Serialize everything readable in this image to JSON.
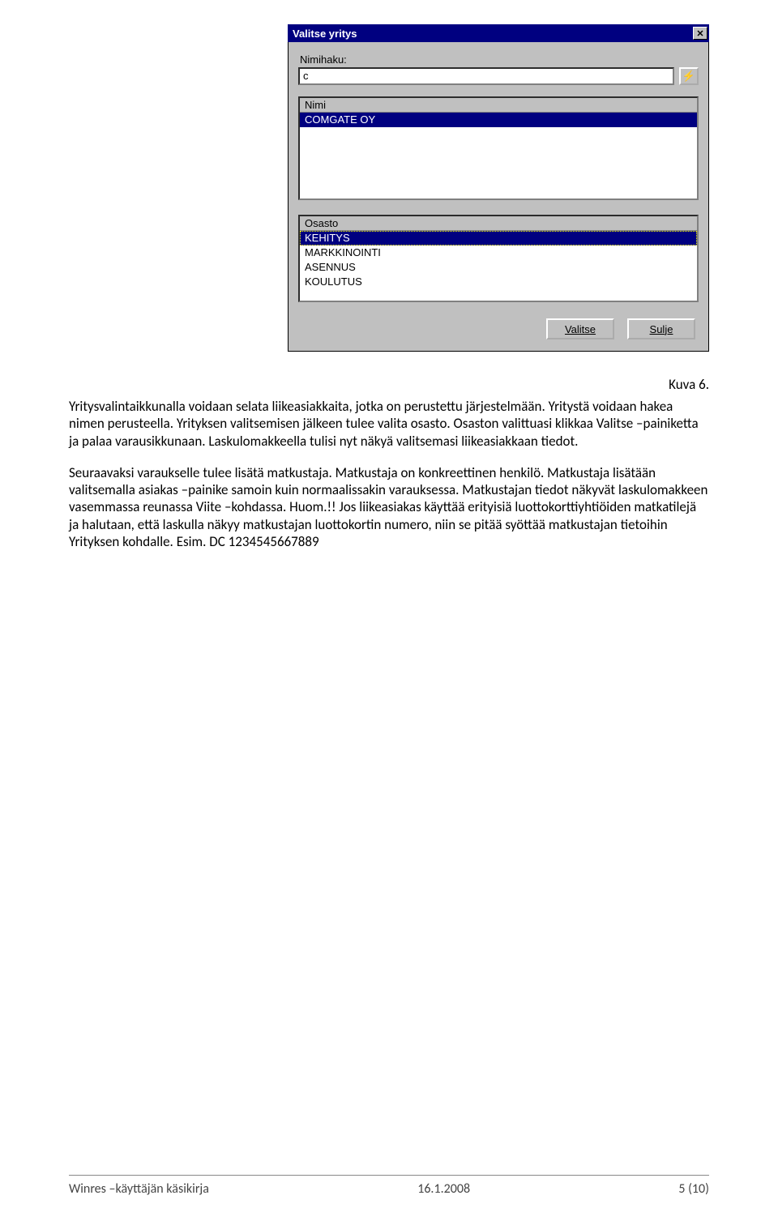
{
  "dialog": {
    "title": "Valitse yritys",
    "search_label": "Nimihaku:",
    "search_value": "c",
    "nimi_header": "Nimi",
    "nimi_items": [
      "COMGATE OY"
    ],
    "osasto_header": "Osasto",
    "osasto_items": [
      "KEHITYS",
      "MARKKINOINTI",
      "ASENNUS",
      "KOULUTUS"
    ],
    "btn_valitse": "Valitse",
    "btn_sulje": "Sulje",
    "lightning_icon": "⚡",
    "close_icon": "✕"
  },
  "caption": "Kuva 6.",
  "para1": "Yritysvalintaikkunalla voidaan selata liikeasiakkaita, jotka on perustettu järjestelmään. Yritystä voidaan hakea nimen perusteella. Yrityksen valitsemisen jälkeen tulee valita osasto. Osaston valittuasi klikkaa Valitse –painiketta ja palaa varausikkunaan. Laskulomakkeella tulisi nyt näkyä valitsemasi liikeasiakkaan tiedot.",
  "para2": "Seuraavaksi varaukselle tulee lisätä matkustaja. Matkustaja on konkreettinen henkilö. Matkustaja lisätään valitsemalla asiakas –painike samoin kuin normaalissakin varauksessa. Matkustajan tiedot näkyvät laskulomakkeen vasemmassa reunassa Viite –kohdassa. Huom.!! Jos liikeasiakas käyttää erityisiä luottokorttiyhtiöiden matkatilejä ja halutaan, että laskulla näkyy matkustajan luottokortin numero, niin se pitää syöttää matkustajan tietoihin Yrityksen kohdalle. Esim. DC 1234545667889",
  "footer": {
    "left": "Winres –käyttäjän käsikirja",
    "center": "16.1.2008",
    "right": "5 (10)"
  }
}
